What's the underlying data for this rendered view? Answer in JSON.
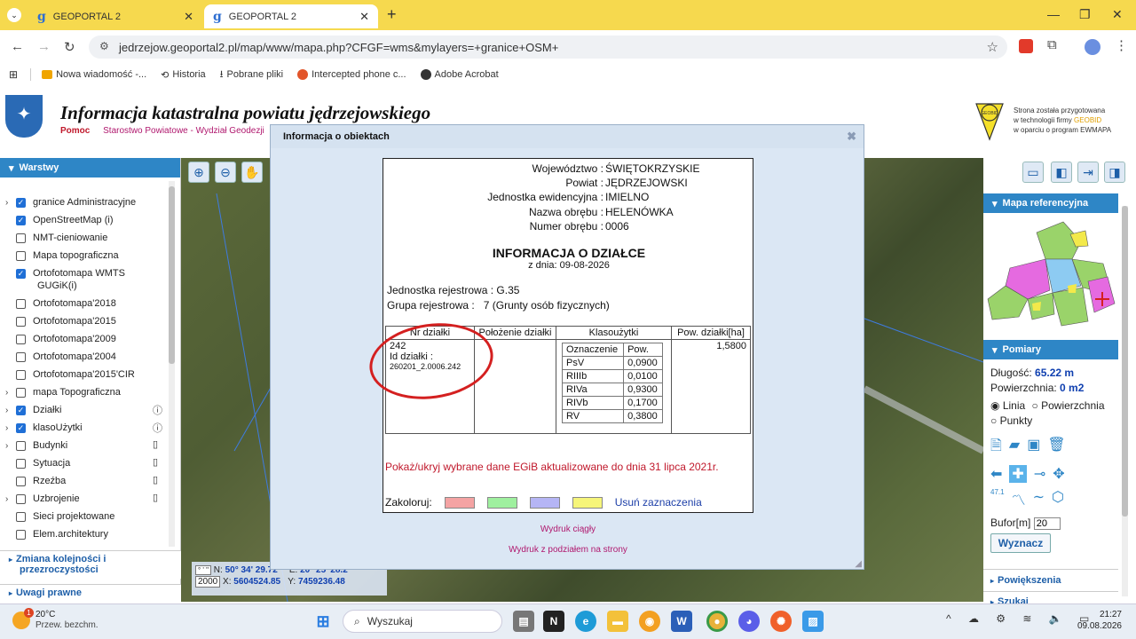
{
  "browser": {
    "tabs": [
      {
        "label": "GEOPORTAL 2"
      },
      {
        "label": "GEOPORTAL 2"
      }
    ],
    "url": "jedrzejow.geoportal2.pl/map/www/mapa.php?CFGF=wms&mylayers=+granice+OSM+",
    "bookmarks": [
      "Nowa wiadomość -...",
      "Historia",
      "Pobrane pliki",
      "Intercepted phone c...",
      "Adobe Acrobat"
    ]
  },
  "header": {
    "title": "Informacja katastralna powiatu jędrzejowskiego",
    "help": "Pomoc",
    "office": "Starostwo Powiatowe - Wydział Geodezji",
    "geobid_line1": "Strona została przygotowana",
    "geobid_line2a": "w technologii firmy ",
    "geobid_brand": "GEOBID",
    "geobid_line3": "w oparciu o program EWMAPA",
    "geobid_logo": "GEOBID"
  },
  "left": {
    "title": "Warstwy",
    "layers": [
      {
        "label": "granice Administracyjne",
        "checked": true,
        "exp": true
      },
      {
        "label": "OpenStreetMap (i)",
        "checked": true,
        "exp": false
      },
      {
        "label": "NMT-cieniowanie",
        "checked": false,
        "exp": false
      },
      {
        "label": "Mapa topograficzna",
        "checked": false,
        "exp": false
      },
      {
        "label": "Ortofotomapa WMTS",
        "label2": "GUGiK(i)",
        "checked": true,
        "exp": false
      },
      {
        "label": "Ortofotomapa'2018",
        "checked": false,
        "exp": false
      },
      {
        "label": "Ortofotomapa'2015",
        "checked": false,
        "exp": false
      },
      {
        "label": "Ortofotomapa'2009",
        "checked": false,
        "exp": false
      },
      {
        "label": "Ortofotomapa'2004",
        "checked": false,
        "exp": false
      },
      {
        "label": "Ortofotomapa'2015'CIR",
        "checked": false,
        "exp": false
      },
      {
        "label": "mapa Topograficzna",
        "checked": false,
        "exp": true
      },
      {
        "label": "Działki",
        "checked": true,
        "exp": true,
        "info": true
      },
      {
        "label": "klasoUżytki",
        "checked": true,
        "exp": true,
        "info": true
      },
      {
        "label": "Budynki",
        "checked": false,
        "exp": true,
        "file": true
      },
      {
        "label": "Sytuacja",
        "checked": false,
        "exp": false,
        "file": true
      },
      {
        "label": "Rzeźba",
        "checked": false,
        "exp": false,
        "file": true
      },
      {
        "label": "Uzbrojenie",
        "checked": false,
        "exp": true,
        "file": true
      },
      {
        "label": "Sieci projektowane",
        "checked": false,
        "exp": false
      },
      {
        "label": "Elem.architektury",
        "checked": false,
        "exp": false
      }
    ],
    "zmiana": "Zmiana kolejności i",
    "zmiana2": "przezroczystości",
    "uwagi": "Uwagi prawne"
  },
  "coords": {
    "n_label": "N:",
    "n": "50° 34' 29.72\"",
    "e_label": "E:",
    "e": "20° 25' 28.2\"",
    "x_label": "X:",
    "x": "5604524.85",
    "y_label": "Y:",
    "y": "7459236.48",
    "epsg": "2000",
    "deg": "° ' \""
  },
  "right": {
    "ref_title": "Mapa referencyjna",
    "pomiary_title": "Pomiary",
    "dlugosc_label": "Długość:",
    "dlugosc": "65.22 m",
    "pow_label": "Powierzchnia:",
    "pow": "0 m2",
    "opt_linia": "Linia",
    "opt_pow": "Powierzchnia",
    "opt_punkty": "Punkty",
    "bufor_label": "Bufor[m]",
    "bufor_value": "20",
    "wyznacz": "Wyznacz",
    "powiekszenia": "Powiększenia",
    "szukaj": "Szukaj",
    "scale_label": "47.1"
  },
  "modal": {
    "title": "Informacja o obiektach",
    "wojewodztwo_k": "Województwo :",
    "wojewodztwo_v": "ŚWIĘTOKRZYSKIE",
    "powiat_k": "Powiat :",
    "powiat_v": "JĘDRZEJOWSKI",
    "jedn_k": "Jednostka ewidencyjna :",
    "jedn_v": "IMIELNO",
    "obreb_k": "Nazwa obrębu :",
    "obreb_v": "HELENÓWKA",
    "nr_obrebu_k": "Numer obrębu :",
    "nr_obrebu_v": "0006",
    "info_title": "INFORMACJA O DZIAŁCE",
    "info_date": "z dnia: 09-08-2026",
    "jr_k": "Jednostka rejestrowa :",
    "jr_v": "G.35",
    "gr_k": "Grupa rejestrowa :",
    "gr_v": "7 (Grunty osób fizycznych)",
    "table": {
      "headers": [
        "Nr działki",
        "Położenie działki",
        "Klasoużytki",
        "Pow. działki[ha]"
      ],
      "nr": "242",
      "id_label": "Id działki :",
      "id": "260201_2.0006.242",
      "pow": "1,5800",
      "inner_headers": [
        "Oznaczenie",
        "Pow."
      ],
      "rows": [
        [
          "PsV",
          "0,0900"
        ],
        [
          "RIIIb",
          "0,0100"
        ],
        [
          "RIVa",
          "0,9300"
        ],
        [
          "RIVb",
          "0,1700"
        ],
        [
          "RV",
          "0,3800"
        ]
      ]
    },
    "showhide": "Pokaż/ukryj wybrane dane EGiB aktualizowane do dnia 31 lipca 2021r.",
    "zakoloruj": "Zakoloruj:",
    "usun": "Usuń zaznaczenia",
    "wydruk1": "Wydruk ciągły",
    "wydruk2": "Wydruk z podziałem na strony",
    "swatches": [
      "#f4a3a3",
      "#9ff09f",
      "#b5b5f5",
      "#f6f57a"
    ]
  },
  "taskbar": {
    "temp": "20°C",
    "weather": "Przew. bezchm.",
    "search": "Wyszukaj",
    "time": "21:27",
    "date": "09.08.2026",
    "badge": "1"
  }
}
